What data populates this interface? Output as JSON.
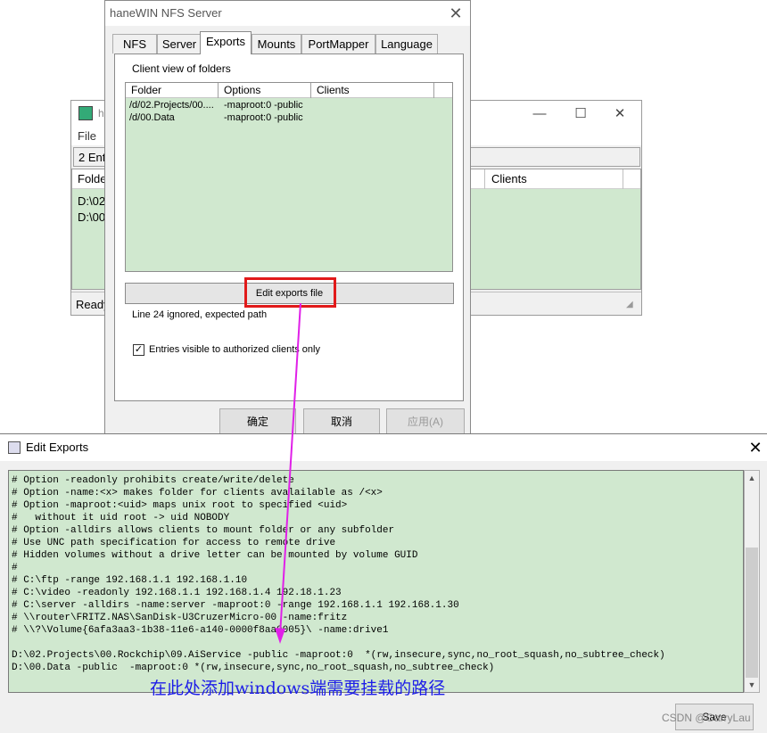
{
  "bg_window": {
    "title": "ha",
    "menu": "File",
    "count_text": "2 Entr",
    "columns": [
      "Folde",
      "Clients"
    ],
    "rows": [
      "D:\\02.",
      "D:\\00."
    ],
    "status": "Ready"
  },
  "dialog": {
    "title": "haneWIN NFS Server",
    "tabs": [
      "NFS",
      "Server",
      "Exports",
      "Mounts",
      "PortMapper",
      "Language"
    ],
    "active_tab": "Exports",
    "group_label": "Client view of folders",
    "columns": [
      "Folder",
      "Options",
      "Clients"
    ],
    "rows": [
      {
        "folder": "/d/02.Projects/00....",
        "options": "-maproot:0 -public",
        "clients": ""
      },
      {
        "folder": "/d/00.Data",
        "options": "-maproot:0 -public",
        "clients": ""
      }
    ],
    "edit_button": "Edit exports file",
    "message": "Line 24 ignored, expected path",
    "checkbox_label": "Entries visible to authorized clients only",
    "checkbox_checked": true,
    "ok": "确定",
    "cancel": "取消",
    "apply": "应用(A)"
  },
  "edit_window": {
    "title": "Edit Exports",
    "content": "# Option -readonly prohibits create/write/delete\n# Option -name:<x> makes folder for clients avalailable as /<x>\n# Option -maproot:<uid> maps unix root to specified <uid>\n#   without it uid root -> uid NOBODY\n# Option -alldirs allows clients to mount folder or any subfolder\n# Use UNC path specification for access to remote drive\n# Hidden volumes without a drive letter can be mounted by volume GUID\n#\n# C:\\ftp -range 192.168.1.1 192.168.1.10\n# C:\\video -readonly 192.168.1.1 192.168.1.4 192.18.1.23\n# C:\\server -alldirs -name:server -maproot:0 -range 192.168.1.1 192.168.1.30\n# \\\\router\\FRITZ.NAS\\SanDisk-U3CruzerMicro-00 -name:fritz\n# \\\\?\\Volume{6afa3aa3-1b38-11e6-a140-0000f8aa0005}\\ -name:drive1\n\nD:\\02.Projects\\00.Rockchip\\09.AiService -public -maproot:0  *(rw,insecure,sync,no_root_squash,no_subtree_check)\nD:\\00.Data -public  -maproot:0 *(rw,insecure,sync,no_root_squash,no_subtree_check)",
    "annotation": "在此处添加windows端需要挂载的路径",
    "save": "Save",
    "watermark": "CSDN @GarryLau"
  },
  "colors": {
    "list_bg": "#d0e8cf",
    "highlight": "#e11a1a",
    "arrow": "#e020e8",
    "annotation": "#1d1de8"
  }
}
